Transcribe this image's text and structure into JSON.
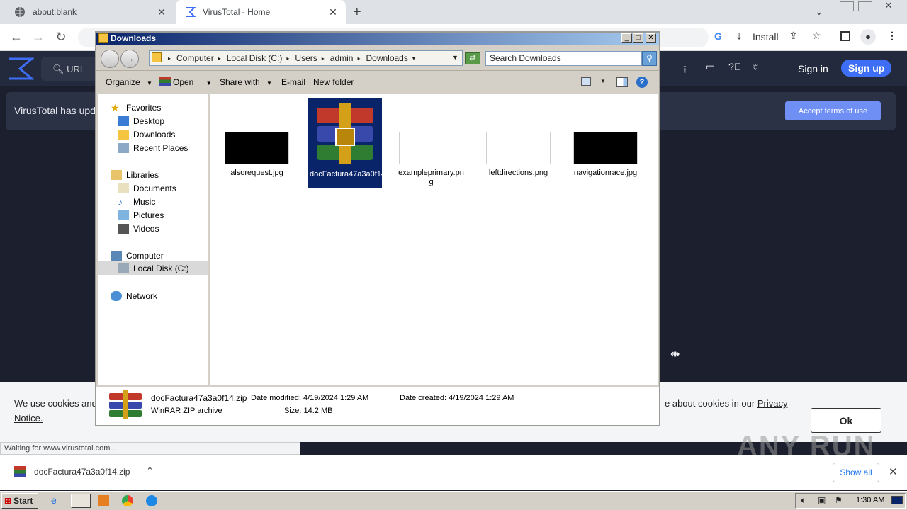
{
  "browser": {
    "tabs": [
      {
        "label": "about:blank"
      },
      {
        "label": "VirusTotal - Home"
      }
    ],
    "new_tab": "+",
    "install_label": "Install",
    "status_text": "Waiting for www.virustotal.com..."
  },
  "virustotal": {
    "search_placeholder": "URL",
    "sign_in": "Sign in",
    "sign_up": "Sign up",
    "banner_text": "VirusTotal has upda",
    "accept_terms": "Accept terms of use",
    "cookie_left_1": "We use cookies and",
    "cookie_left_2": "Notice.",
    "cookie_right": "e about cookies in our",
    "cookie_link": "Privacy",
    "ok": "Ok"
  },
  "explorer": {
    "title": "Downloads",
    "breadcrumb": [
      "Computer",
      "Local Disk (C:)",
      "Users",
      "admin",
      "Downloads"
    ],
    "search_placeholder": "Search Downloads",
    "commands": [
      "Organize",
      "Open",
      "Share with",
      "E-mail",
      "New folder"
    ],
    "nav": {
      "favorites": "Favorites",
      "fav_items": [
        "Desktop",
        "Downloads",
        "Recent Places"
      ],
      "libraries": "Libraries",
      "lib_items": [
        "Documents",
        "Music",
        "Pictures",
        "Videos"
      ],
      "computer": "Computer",
      "computer_items": [
        "Local Disk (C:)"
      ],
      "network": "Network"
    },
    "files": [
      {
        "name": "alsorequest.jpg"
      },
      {
        "name": "docFactura47a3a0f14.zip"
      },
      {
        "name": "exampleprimary.png"
      },
      {
        "name": "leftdirections.png"
      },
      {
        "name": "navigationrace.jpg"
      }
    ],
    "details": {
      "file_name": "docFactura47a3a0f14.zip",
      "file_type": "WinRAR ZIP archive",
      "date_modified": "Date modified: 4/19/2024 1:29 AM",
      "size": "Size: 14.2 MB",
      "date_created": "Date created: 4/19/2024 1:29 AM"
    }
  },
  "downloads_bar": {
    "item": "docFactura47a3a0f14.zip",
    "show_all": "Show all"
  },
  "taskbar": {
    "start": "Start",
    "clock": "1:30 AM"
  },
  "watermark": "ANY RUN",
  "colors": {
    "vt_dark": "#1b1f2e",
    "selection": "#0a246a",
    "accent_blue": "#3d6ef5"
  }
}
